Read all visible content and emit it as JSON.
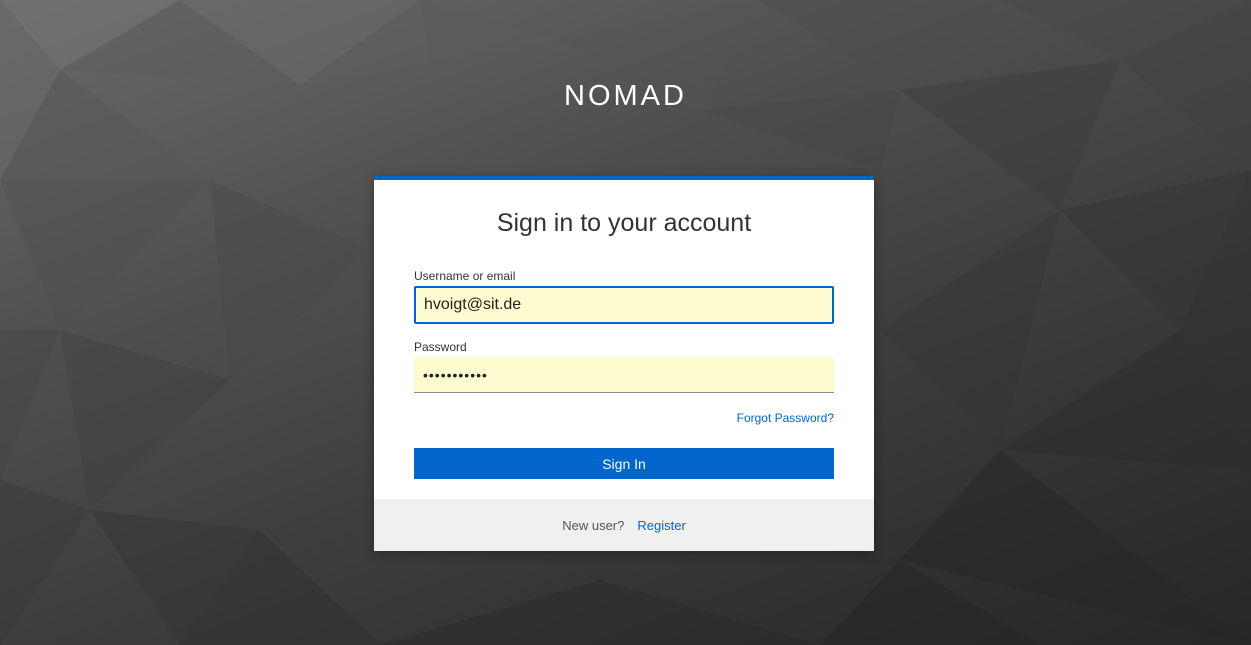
{
  "brand": {
    "title": "NOMAD"
  },
  "login": {
    "heading": "Sign in to your account",
    "username_label": "Username or email",
    "username_value": "hvoigt@sit.de",
    "password_label": "Password",
    "password_value": "•••••••••••",
    "forgot_password_label": "Forgot Password?",
    "signin_label": "Sign In",
    "new_user_text": "New user?",
    "register_label": "Register"
  },
  "colors": {
    "accent": "#0066cc",
    "autofill_background": "#fdfcd0",
    "footer_background": "#f0f0f0"
  }
}
